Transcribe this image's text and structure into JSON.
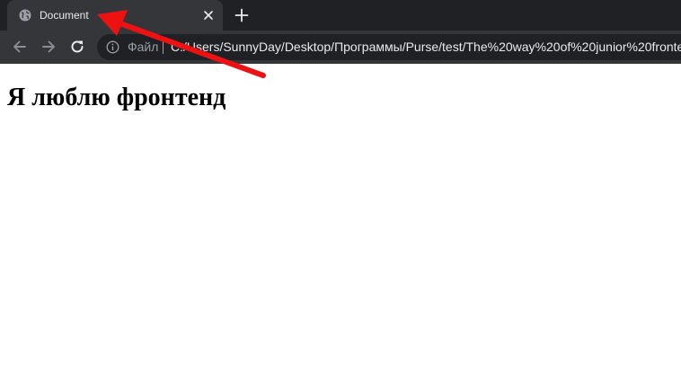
{
  "tab": {
    "title": "Document",
    "favicon": "globe-icon"
  },
  "toolbar": {
    "back_icon": "arrow-left-icon",
    "forward_icon": "arrow-right-icon",
    "reload_icon": "reload-icon",
    "site_info_icon": "info-icon",
    "file_label": "Файл",
    "url": "C:/Users/SunnyDay/Desktop/Программы/Purse/test/The%20way%20of%20junior%20fronte"
  },
  "page": {
    "heading": "Я люблю фронтенд"
  },
  "colors": {
    "tabstrip": "#202124",
    "active_tab": "#35363a",
    "omnibox": "#202124",
    "annotation_arrow": "#ee1111"
  }
}
